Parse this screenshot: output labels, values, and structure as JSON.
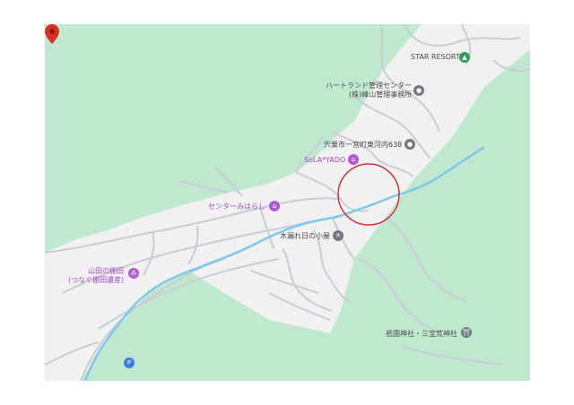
{
  "map": {
    "colors": {
      "terrain": "#bfe8cf",
      "developed_area": "#f1f1f1",
      "road": "#c8cdd3",
      "river": "#7cc8ec",
      "highlight_circle": "#d0323a",
      "marker": "#d93025"
    },
    "places": [
      {
        "id": "star_resort",
        "name": "STAR RESORT",
        "icon": "mountain-icon",
        "glyph": "▲"
      },
      {
        "id": "heartland",
        "name": "ハートランド管理センター",
        "name2": "(株)峰山管理事務所",
        "icon": "place-icon",
        "glyph": "●"
      },
      {
        "id": "address",
        "name": "宍粟市一宮町東河内638",
        "icon": "place-icon",
        "glyph": "●"
      },
      {
        "id": "sola_yado",
        "name": "SoLA*YADO",
        "icon": "hotel-icon",
        "glyph": "⌂"
      },
      {
        "id": "center_mihara",
        "name": "センターみはらし",
        "icon": "home-icon",
        "glyph": "⌂"
      },
      {
        "id": "komorebi",
        "name": "木漏れ日の小屋",
        "icon": "shelter-icon",
        "glyph": "✕"
      },
      {
        "id": "yamada",
        "name": "山田の棚田",
        "name2": "(つなぐ棚田遺産)",
        "icon": "landmark-icon",
        "glyph": "⁂"
      },
      {
        "id": "gion",
        "name": "祇園神社・三宝荒神社",
        "icon": "shrine-icon",
        "glyph": "⛩"
      },
      {
        "id": "parking",
        "name": "",
        "icon": "parking-icon",
        "glyph": "P"
      }
    ]
  }
}
